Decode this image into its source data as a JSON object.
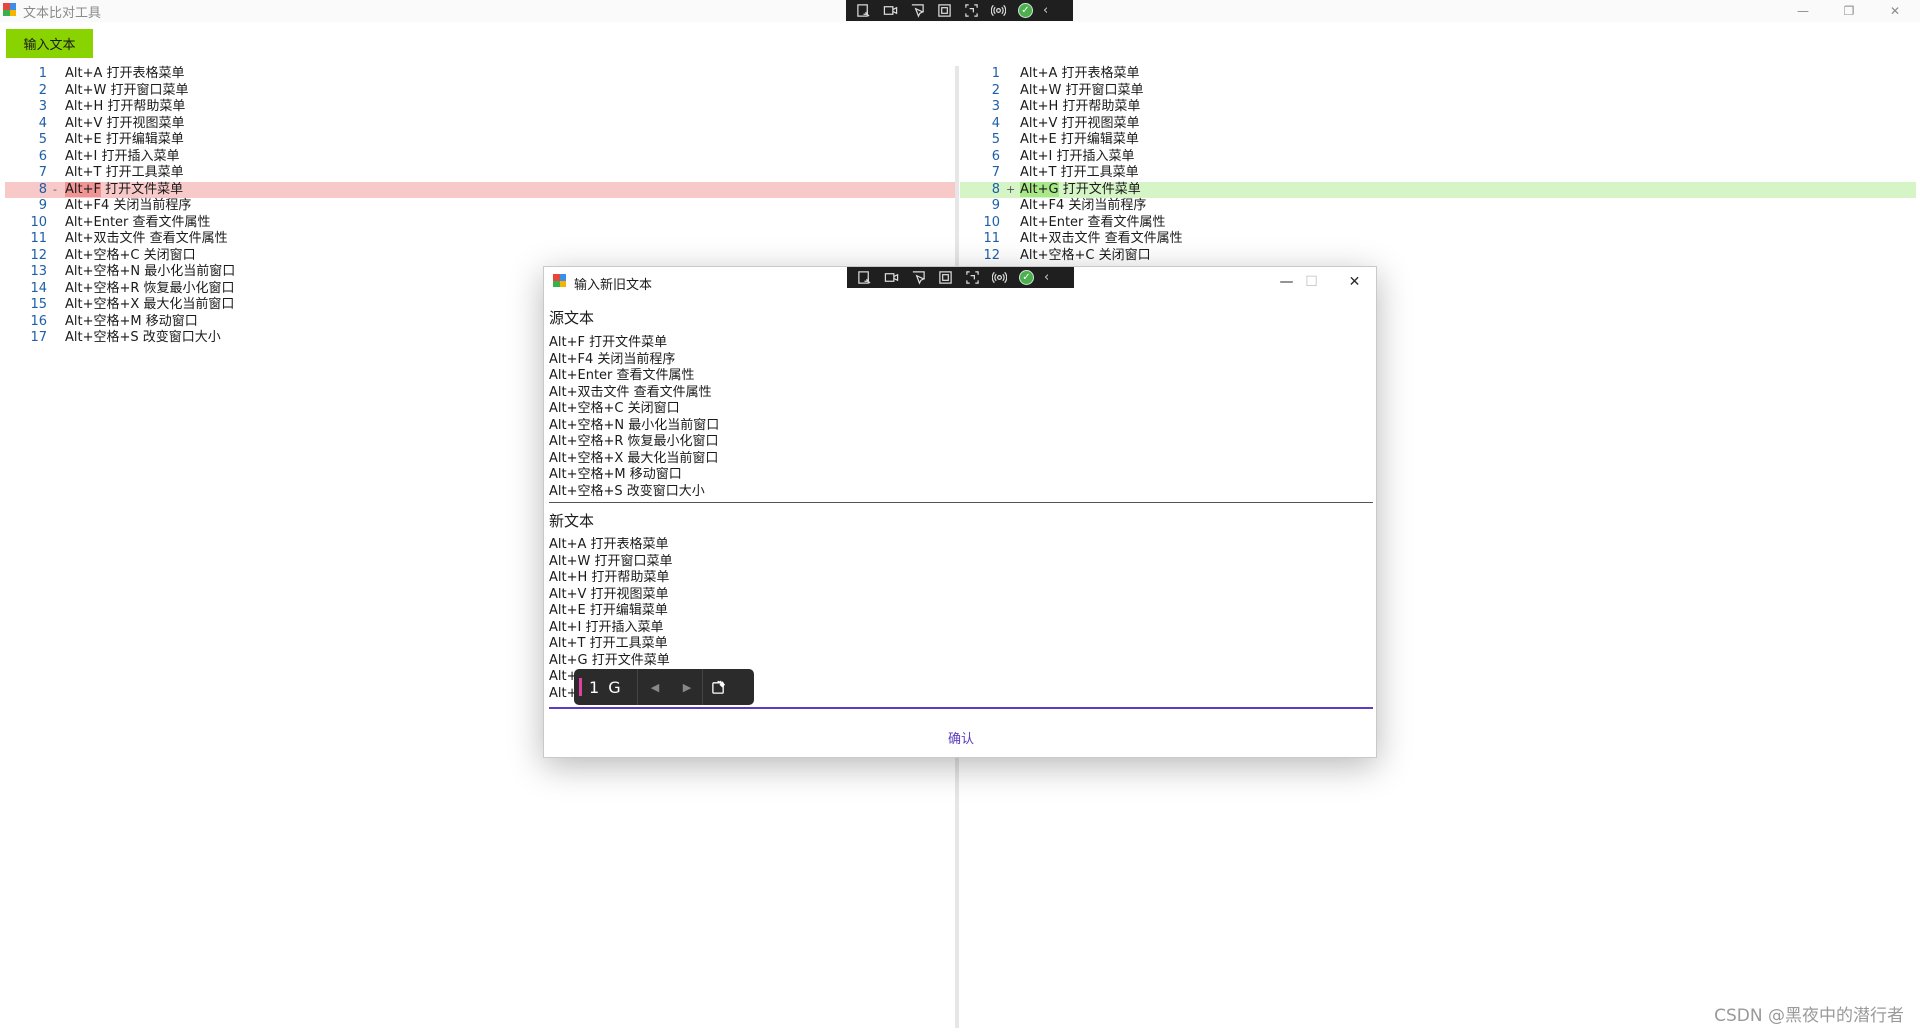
{
  "window": {
    "title": "文本比对工具",
    "minimize_glyph": "—",
    "restore_glyph": "❐",
    "close_glyph": "✕"
  },
  "recorder_toolbar": {
    "icons": [
      "screenshot-icon",
      "video-icon",
      "pointer-icon",
      "region-icon",
      "window-capture-icon",
      "audio-icon",
      "check-icon",
      "collapse-icon"
    ],
    "check_glyph": "✓",
    "chevron_glyph": "‹"
  },
  "toolbar": {
    "input_button_label": "输入文本"
  },
  "diff": {
    "left_lines": [
      {
        "n": "1",
        "mark": "",
        "text": "Alt+A 打开表格菜单",
        "state": "normal"
      },
      {
        "n": "2",
        "mark": "",
        "text": "Alt+W 打开窗口菜单",
        "state": "normal"
      },
      {
        "n": "3",
        "mark": "",
        "text": "Alt+H 打开帮助菜单",
        "state": "normal"
      },
      {
        "n": "4",
        "mark": "",
        "text": "Alt+V 打开视图菜单",
        "state": "normal"
      },
      {
        "n": "5",
        "mark": "",
        "text": "Alt+E 打开编辑菜单",
        "state": "normal"
      },
      {
        "n": "6",
        "mark": "",
        "text": "Alt+I 打开插入菜单",
        "state": "normal"
      },
      {
        "n": "7",
        "mark": "",
        "text": "Alt+T 打开工具菜单",
        "state": "normal"
      },
      {
        "n": "8",
        "mark": "-",
        "text": "Alt+F 打开文件菜单",
        "state": "removed",
        "hl": "Alt+F"
      },
      {
        "n": "9",
        "mark": "",
        "text": "Alt+F4 关闭当前程序",
        "state": "normal"
      },
      {
        "n": "10",
        "mark": "",
        "text": "Alt+Enter 查看文件属性",
        "state": "normal"
      },
      {
        "n": "11",
        "mark": "",
        "text": "Alt+双击文件 查看文件属性",
        "state": "normal"
      },
      {
        "n": "12",
        "mark": "",
        "text": "Alt+空格+C 关闭窗口",
        "state": "normal"
      },
      {
        "n": "13",
        "mark": "",
        "text": "Alt+空格+N 最小化当前窗口",
        "state": "normal"
      },
      {
        "n": "14",
        "mark": "",
        "text": "Alt+空格+R 恢复最小化窗口",
        "state": "normal"
      },
      {
        "n": "15",
        "mark": "",
        "text": "Alt+空格+X 最大化当前窗口",
        "state": "normal"
      },
      {
        "n": "16",
        "mark": "",
        "text": "Alt+空格+M 移动窗口",
        "state": "normal"
      },
      {
        "n": "17",
        "mark": "",
        "text": "Alt+空格+S 改变窗口大小",
        "state": "normal"
      }
    ],
    "right_lines": [
      {
        "n": "1",
        "mark": "",
        "text": "Alt+A 打开表格菜单",
        "state": "normal"
      },
      {
        "n": "2",
        "mark": "",
        "text": "Alt+W 打开窗口菜单",
        "state": "normal"
      },
      {
        "n": "3",
        "mark": "",
        "text": "Alt+H 打开帮助菜单",
        "state": "normal"
      },
      {
        "n": "4",
        "mark": "",
        "text": "Alt+V 打开视图菜单",
        "state": "normal"
      },
      {
        "n": "5",
        "mark": "",
        "text": "Alt+E 打开编辑菜单",
        "state": "normal"
      },
      {
        "n": "6",
        "mark": "",
        "text": "Alt+I 打开插入菜单",
        "state": "normal"
      },
      {
        "n": "7",
        "mark": "",
        "text": "Alt+T 打开工具菜单",
        "state": "normal"
      },
      {
        "n": "8",
        "mark": "+",
        "text": "Alt+G 打开文件菜单",
        "state": "added",
        "hl": "Alt+G"
      },
      {
        "n": "9",
        "mark": "",
        "text": "Alt+F4 关闭当前程序",
        "state": "normal"
      },
      {
        "n": "10",
        "mark": "",
        "text": "Alt+Enter 查看文件属性",
        "state": "normal"
      },
      {
        "n": "11",
        "mark": "",
        "text": "Alt+双击文件 查看文件属性",
        "state": "normal"
      },
      {
        "n": "12",
        "mark": "",
        "text": "Alt+空格+C 关闭窗口",
        "state": "normal"
      }
    ]
  },
  "dialog": {
    "title": "输入新旧文本",
    "minimize_glyph": "—",
    "maximize_glyph": "☐",
    "close_glyph": "✕",
    "source_label": "源文本",
    "source_lines": [
      "Alt+F 打开文件菜单",
      "Alt+F4 关闭当前程序",
      "Alt+Enter 查看文件属性",
      "Alt+双击文件 查看文件属性",
      "Alt+空格+C 关闭窗口",
      "Alt+空格+N 最小化当前窗口",
      "Alt+空格+R 恢复最小化窗口",
      "Alt+空格+X 最大化当前窗口",
      "Alt+空格+M 移动窗口",
      "Alt+空格+S 改变窗口大小"
    ],
    "new_label": "新文本",
    "new_lines": [
      "Alt+A 打开表格菜单",
      "Alt+W 打开窗口菜单",
      "Alt+H 打开帮助菜单",
      "Alt+V 打开视图菜单",
      "Alt+E 打开编辑菜单",
      "Alt+I 打开插入菜单",
      "Alt+T 打开工具菜单",
      "Alt+G 打开文件菜单",
      "Alt+",
      "Alt+"
    ],
    "confirm_label": "确认"
  },
  "ime": {
    "composition": "1 G",
    "prev_glyph": "◀",
    "next_glyph": "▶"
  },
  "watermark": "CSDN @黑夜中的潜行者"
}
